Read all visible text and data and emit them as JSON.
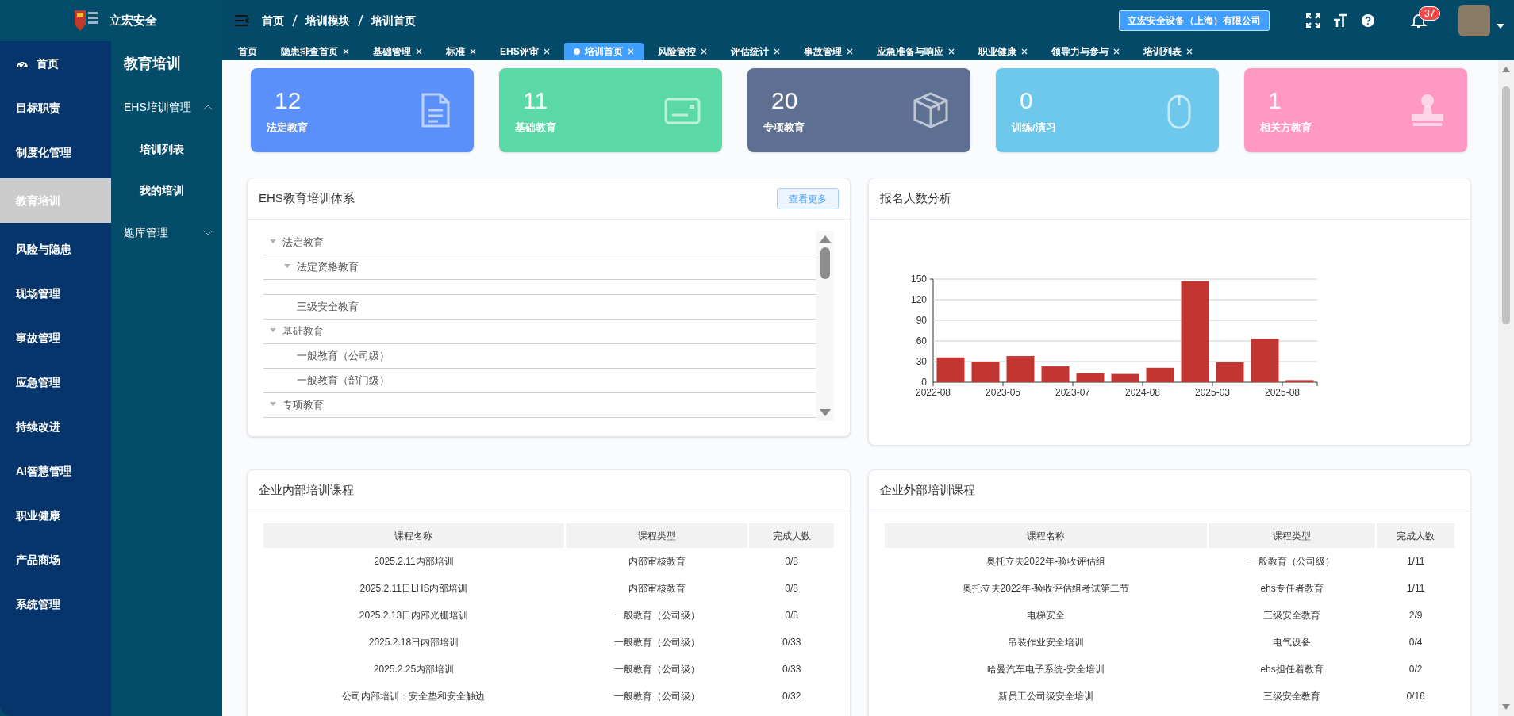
{
  "sidebar": {
    "logo_text": "立宏安全",
    "items": [
      {
        "label": "首页",
        "selected": false
      },
      {
        "label": "目标职责",
        "selected": false
      },
      {
        "label": "制度化管理",
        "selected": false
      },
      {
        "label": "教育培训",
        "selected": true
      },
      {
        "label": "风险与隐患",
        "selected": false
      },
      {
        "label": "现场管理",
        "selected": false
      },
      {
        "label": "事故管理",
        "selected": false
      },
      {
        "label": "应急管理",
        "selected": false
      },
      {
        "label": "持续改进",
        "selected": false
      },
      {
        "label": "AI智慧管理",
        "selected": false
      },
      {
        "label": "职业健康",
        "selected": false
      },
      {
        "label": "产品商场",
        "selected": false
      },
      {
        "label": "系统管理",
        "selected": false
      }
    ]
  },
  "submenu": {
    "title": "教育培训",
    "groups": [
      {
        "label": "EHS培训管理",
        "expanded": true,
        "items": [
          "培训列表",
          "我的培训"
        ]
      },
      {
        "label": "题库管理",
        "expanded": false
      }
    ]
  },
  "header": {
    "breadcrumb": [
      "首页",
      "培训模块",
      "培训首页"
    ],
    "company": "立宏安全设备（上海）有限公司",
    "notification_count": "37"
  },
  "tabs": [
    {
      "label": "首页",
      "selected": false,
      "closable": false
    },
    {
      "label": "隐患排查首页",
      "selected": false,
      "closable": true
    },
    {
      "label": "基础管理",
      "selected": false,
      "closable": true
    },
    {
      "label": "标准",
      "selected": false,
      "closable": true
    },
    {
      "label": "EHS评审",
      "selected": false,
      "closable": true
    },
    {
      "label": "培训首页",
      "selected": true,
      "closable": true
    },
    {
      "label": "风险管控",
      "selected": false,
      "closable": true
    },
    {
      "label": "评估统计",
      "selected": false,
      "closable": true
    },
    {
      "label": "事故管理",
      "selected": false,
      "closable": true
    },
    {
      "label": "应急准备与响应",
      "selected": false,
      "closable": true
    },
    {
      "label": "职业健康",
      "selected": false,
      "closable": true
    },
    {
      "label": "领导力与参与",
      "selected": false,
      "closable": true
    },
    {
      "label": "培训列表",
      "selected": false,
      "closable": true
    }
  ],
  "stats": [
    {
      "value": "12",
      "label": "法定教育",
      "color": "#5b8ff9"
    },
    {
      "value": "11",
      "label": "基础教育",
      "color": "#5ad8a6"
    },
    {
      "value": "20",
      "label": "专项教育",
      "color": "#5d7092"
    },
    {
      "value": "0",
      "label": "训练/演习",
      "color": "#6dc8ec"
    },
    {
      "value": "1",
      "label": "相关方教育",
      "color": "#ff99c3"
    }
  ],
  "tree_panel": {
    "title": "EHS教育培训体系",
    "more_button": "查看更多",
    "nodes": [
      {
        "label": "法定教育",
        "expanded": true,
        "children": [
          {
            "label": "法定资格教育",
            "expanded": true
          },
          {
            "label": "三级安全教育"
          }
        ]
      },
      {
        "label": "基础教育",
        "expanded": true,
        "children": [
          {
            "label": "一般教育（公司级）"
          },
          {
            "label": "一般教育（部门级）"
          }
        ]
      },
      {
        "label": "专项教育",
        "expanded": true
      }
    ]
  },
  "chart_panel": {
    "title": "报名人数分析",
    "chart_data": {
      "type": "bar",
      "categories": [
        "2022-08",
        null,
        "2023-05",
        null,
        "2023-07",
        null,
        "2024-08",
        null,
        "2025-03",
        null,
        "2025-08"
      ],
      "ylim": [
        0,
        150
      ],
      "grid": true,
      "yticks": [
        0,
        30,
        60,
        90,
        120,
        150
      ],
      "series": [
        {
          "color": "#c23531",
          "values": [
            36,
            30,
            38,
            23,
            13,
            12,
            21,
            147,
            29,
            63,
            3
          ]
        }
      ]
    }
  },
  "internal_courses": {
    "title": "企业内部培训课程",
    "columns": [
      "课程名称",
      "课程类型",
      "完成人数"
    ],
    "rows": [
      [
        "2025.2.11内部培训",
        "内部审核教育",
        "0/8"
      ],
      [
        "2025.2.11日LHS内部培训",
        "内部审核教育",
        "0/8"
      ],
      [
        "2025.2.13日内部光栅培训",
        "一般教育（公司级）",
        "0/8"
      ],
      [
        "2025.2.18日内部培训",
        "一般教育（公司级）",
        "0/33"
      ],
      [
        "2025.2.25内部培训",
        "一般教育（公司级）",
        "0/33"
      ],
      [
        "公司内部培训：安全垫和安全触边",
        "一般教育（公司级）",
        "0/32"
      ]
    ]
  },
  "external_courses": {
    "title": "企业外部培训课程",
    "columns": [
      "课程名称",
      "课程类型",
      "完成人数"
    ],
    "rows": [
      [
        "奥托立夫2022年-验收评估组",
        "一般教育（公司级）",
        "1/11"
      ],
      [
        "奥托立夫2022年-验收评估组考试第二节",
        "ehs专任者教育",
        "1/11"
      ],
      [
        "电梯安全",
        "三级安全教育",
        "2/9"
      ],
      [
        "吊装作业安全培训",
        "电气设备",
        "0/4"
      ],
      [
        "哈曼汽车电子系统-安全培训",
        "ehs担任着教育",
        "0/2"
      ],
      [
        "新员工公司级安全培训",
        "三级安全教育",
        "0/16"
      ]
    ]
  }
}
